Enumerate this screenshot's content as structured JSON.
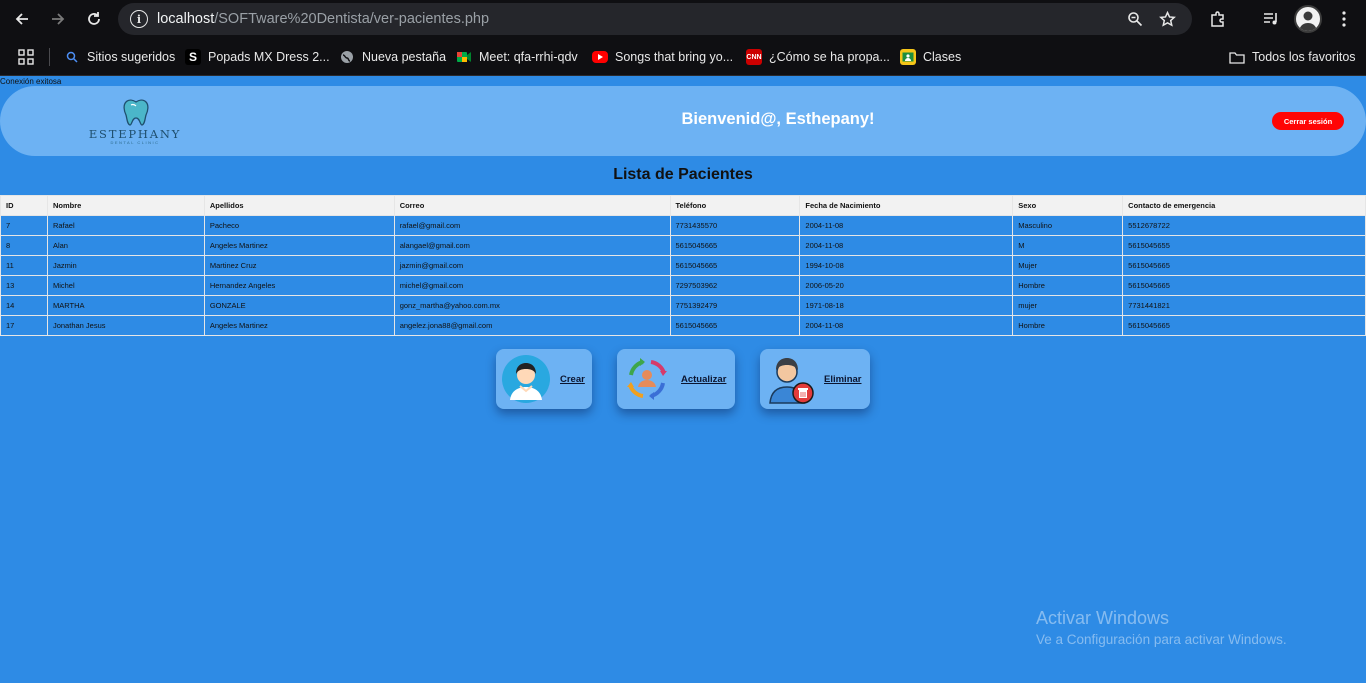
{
  "browser": {
    "url_host": "localhost",
    "url_path": "/SOFTware%20Dentista/ver-pacientes.php",
    "bookmarks": [
      {
        "label": "Sitios sugeridos",
        "icon": "search-icon"
      },
      {
        "label": "Popads MX Dress 2...",
        "icon": "s-favicon"
      },
      {
        "label": "Nueva pestaña",
        "icon": "globe-icon"
      },
      {
        "label": "Meet: qfa-rrhi-qdv",
        "icon": "meet-icon"
      },
      {
        "label": "Songs that bring yo...",
        "icon": "youtube-icon"
      },
      {
        "label": "¿Cómo se ha propa...",
        "icon": "cnn-icon"
      },
      {
        "label": "Clases",
        "icon": "classroom-icon"
      }
    ],
    "all_bookmarks_label": "Todos los favoritos"
  },
  "page": {
    "status_text": "Conexión exitosa",
    "logo": {
      "name": "ESTEPHANY",
      "subtitle": "DENTAL CLINIC"
    },
    "welcome": "Bienvenid@, Esthepany!",
    "logout_label": "Cerrar sesión",
    "list_title": "Lista de Pacientes",
    "table": {
      "headers": [
        "ID",
        "Nombre",
        "Apellidos",
        "Correo",
        "Teléfono",
        "Fecha de Nacimiento",
        "Sexo",
        "Contacto de emergencia"
      ],
      "rows": [
        [
          "7",
          "Rafael",
          "Pacheco",
          "rafael@gmail.com",
          "7731435570",
          "2004-11-08",
          "Masculino",
          "5512678722"
        ],
        [
          "8",
          "Alan",
          "Angeles Martinez",
          "alangael@gmail.com",
          "5615045665",
          "2004-11-08",
          "M",
          "5615045655"
        ],
        [
          "11",
          "Jazmin",
          "Martinez Cruz",
          "jazmin@gmail.com",
          "5615045665",
          "1994-10-08",
          "Mujer",
          "5615045665"
        ],
        [
          "13",
          "Michel",
          "Hernandez Angeles",
          "michel@gmail.com",
          "7297503962",
          "2006-05-20",
          "Hombre",
          "5615045665"
        ],
        [
          "14",
          "MARTHA",
          "GONZALE",
          "gonz_martha@yahoo.com.mx",
          "7751392479",
          "1971-08-18",
          "mujer",
          "7731441821"
        ],
        [
          "17",
          "Jonathan Jesus",
          "Angeles Martinez",
          "angelez.jona88@gmail.com",
          "5615045665",
          "2004-11-08",
          "Hombre",
          "5615045665"
        ]
      ]
    },
    "actions": [
      {
        "label": "Crear",
        "icon": "user-add-icon"
      },
      {
        "label": "Actualizar",
        "icon": "refresh-user-icon"
      },
      {
        "label": "Eliminar",
        "icon": "user-delete-icon"
      }
    ],
    "watermark": {
      "line1": "Activar Windows",
      "line2": "Ve a Configuración para activar Windows."
    }
  },
  "colors": {
    "page_bg": "#2e8be5",
    "header_bg": "#6db2f3",
    "logout_bg": "#ff0505"
  }
}
